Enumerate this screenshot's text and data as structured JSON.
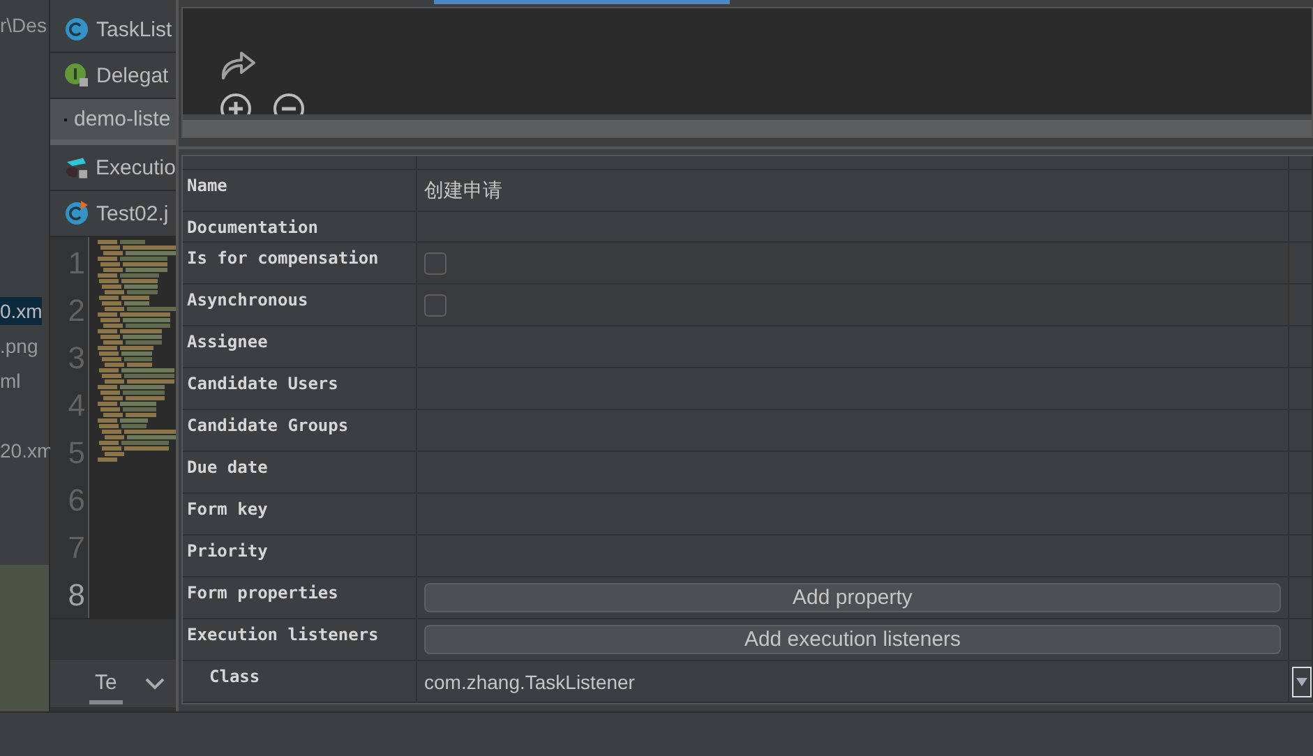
{
  "project_tree": {
    "items": [
      {
        "label": "r\\Des",
        "selected": false
      },
      {
        "label": "0.xm",
        "selected": true
      },
      {
        "label": ".png",
        "selected": false
      },
      {
        "label": "ml",
        "selected": false
      },
      {
        "label": "20.xm",
        "selected": false
      }
    ]
  },
  "editor_tabs": [
    {
      "label": "TaskList",
      "kind": "class",
      "selected": false
    },
    {
      "label": "Delegat",
      "kind": "interface",
      "selected": false
    },
    {
      "label": "demo-liste",
      "kind": "xml",
      "selected": true
    },
    {
      "label": "Executio",
      "kind": "listener",
      "selected": false
    },
    {
      "label": "Test02.j",
      "kind": "test",
      "selected": false
    }
  ],
  "gutter": {
    "line_numbers": [
      "1",
      "2",
      "3",
      "4",
      "5",
      "6",
      "7",
      "8"
    ]
  },
  "bottom_tab": {
    "label": "Te"
  },
  "properties": [
    {
      "name": "Name",
      "kind": "text",
      "value": "创建申请"
    },
    {
      "name": "Documentation",
      "kind": "text"
    },
    {
      "name": "Is for compensation",
      "kind": "checkbox",
      "checked": false
    },
    {
      "name": "Asynchronous",
      "kind": "checkbox",
      "checked": false
    },
    {
      "name": "Assignee",
      "kind": "text"
    },
    {
      "name": "Candidate Users",
      "kind": "text"
    },
    {
      "name": "Candidate Groups",
      "kind": "text"
    },
    {
      "name": "Due date",
      "kind": "text"
    },
    {
      "name": "Form key",
      "kind": "text"
    },
    {
      "name": "Priority",
      "kind": "text"
    },
    {
      "name": "Form properties",
      "kind": "button",
      "button": "Add property"
    },
    {
      "name": "Execution listeners",
      "kind": "button",
      "button": "Add execution listeners",
      "children": [
        {
          "name": "Class",
          "kind": "dropdown",
          "value": "com.zhang.TaskListener"
        }
      ]
    }
  ]
}
